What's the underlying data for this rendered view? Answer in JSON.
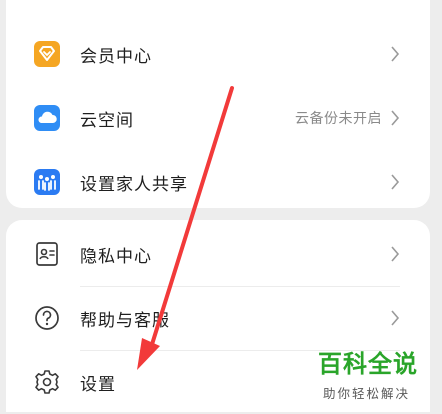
{
  "menu_group_1": [
    {
      "label": "会员中心",
      "icon": "member-diamond-icon"
    },
    {
      "label": "云空间",
      "icon": "cloud-icon",
      "status": "云备份未开启"
    },
    {
      "label": "设置家人共享",
      "icon": "family-share-icon"
    }
  ],
  "menu_group_2": [
    {
      "label": "隐私中心",
      "icon": "privacy-card-icon"
    },
    {
      "label": "帮助与客服",
      "icon": "help-question-icon"
    },
    {
      "label": "设置",
      "icon": "gear-icon"
    }
  ],
  "watermark": {
    "title": "百科全说",
    "subtitle": "助你轻松解决"
  },
  "colors": {
    "member_icon": "#f5a623",
    "cloud_icon": "#2f8df5",
    "family_icon": "#2b7bf2",
    "annotation_arrow": "#f23a3a",
    "watermark_green": "#2aa52a"
  }
}
